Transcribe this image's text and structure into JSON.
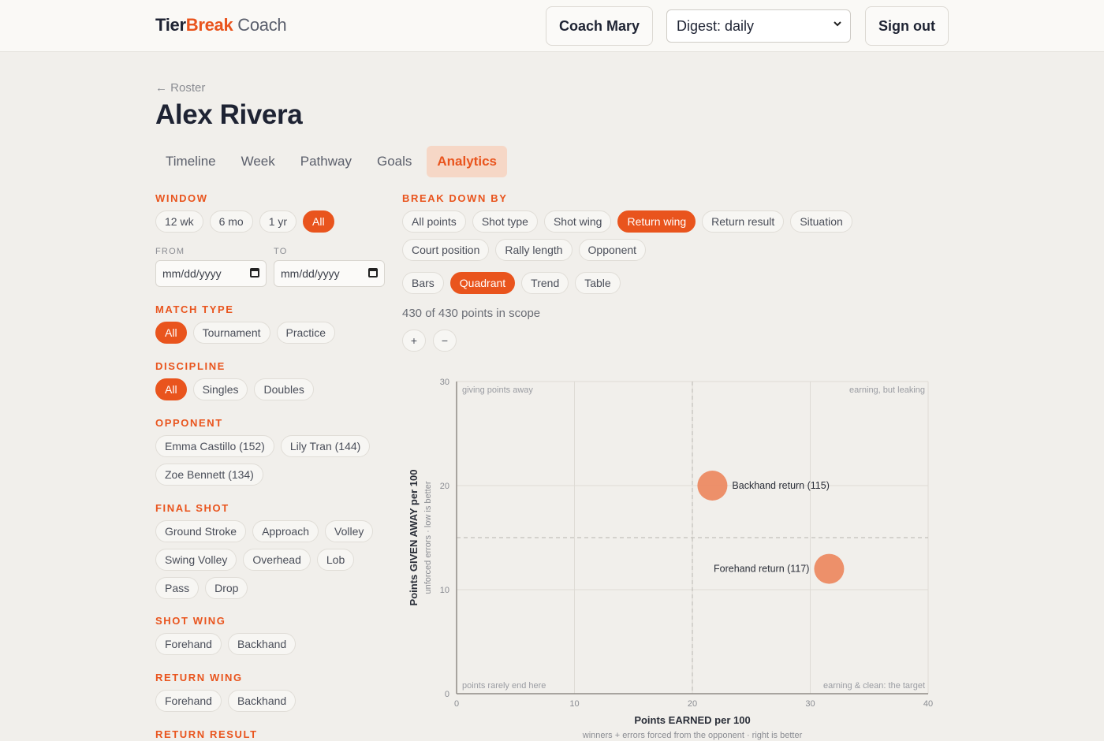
{
  "header": {
    "brand_part1": "Tier",
    "brand_part2": "Break",
    "brand_part3": "Coach",
    "coach_label": "Coach Mary",
    "digest_value": "Digest: daily",
    "signout_label": "Sign out"
  },
  "page": {
    "back_label": "← Roster",
    "player_name": "Alex Rivera",
    "tabs": [
      "Timeline",
      "Week",
      "Pathway",
      "Goals",
      "Analytics"
    ],
    "active_tab": "Analytics"
  },
  "filters": {
    "window": {
      "label": "WINDOW",
      "options": [
        "12 wk",
        "6 mo",
        "1 yr",
        "All"
      ],
      "selected": "All"
    },
    "from_label": "FROM",
    "to_label": "TO",
    "from_placeholder": "mm/dd/yyyy",
    "to_placeholder": "mm/dd/yyyy",
    "match_type": {
      "label": "MATCH TYPE",
      "options": [
        "All",
        "Tournament",
        "Practice"
      ],
      "selected": "All"
    },
    "discipline": {
      "label": "DISCIPLINE",
      "options": [
        "All",
        "Singles",
        "Doubles"
      ],
      "selected": "All"
    },
    "opponent": {
      "label": "OPPONENT",
      "options": [
        "Emma Castillo (152)",
        "Lily Tran (144)",
        "Zoe Bennett (134)"
      ]
    },
    "final_shot": {
      "label": "FINAL SHOT",
      "options": [
        "Ground Stroke",
        "Approach",
        "Volley",
        "Swing Volley",
        "Overhead",
        "Lob",
        "Pass",
        "Drop"
      ]
    },
    "shot_wing": {
      "label": "SHOT WING",
      "options": [
        "Forehand",
        "Backhand"
      ]
    },
    "return_wing": {
      "label": "RETURN WING",
      "options": [
        "Forehand",
        "Backhand"
      ]
    },
    "return_result": {
      "label": "RETURN RESULT"
    }
  },
  "breakdown": {
    "label": "BREAK DOWN BY",
    "options": [
      "All points",
      "Shot type",
      "Shot wing",
      "Return wing",
      "Return result",
      "Situation",
      "Court position",
      "Rally length",
      "Opponent"
    ],
    "selected": "Return wing",
    "views": [
      "Bars",
      "Quadrant",
      "Trend",
      "Table"
    ],
    "selected_view": "Quadrant",
    "scope_text": "430 of 430 points in scope",
    "zoom_in": "+",
    "zoom_out": "−"
  },
  "colors": {
    "accent": "#e9541d",
    "bubble": "#ec8a63"
  },
  "chart_data": {
    "type": "scatter",
    "xlabel": "Points EARNED per 100",
    "xsublabel": "winners + errors forced from the opponent · right is better",
    "ylabel": "Points GIVEN AWAY per 100",
    "ysublabel": "unforced errors · low is better",
    "xlim": [
      0,
      40
    ],
    "ylim": [
      0,
      30
    ],
    "xticks": [
      0,
      10,
      20,
      30,
      40
    ],
    "yticks": [
      0,
      10,
      20,
      30
    ],
    "x_reference": 20,
    "y_reference": 15,
    "grid": true,
    "quadrant_labels": {
      "top_left": "giving points away",
      "top_right": "earning, but leaking",
      "bottom_left": "points rarely end here",
      "bottom_right": "earning & clean: the target"
    },
    "points": [
      {
        "label": "Backhand return (115)",
        "x": 21.7,
        "y": 20,
        "n": 115
      },
      {
        "label": "Forehand return (117)",
        "x": 31.6,
        "y": 12,
        "n": 117
      }
    ]
  }
}
